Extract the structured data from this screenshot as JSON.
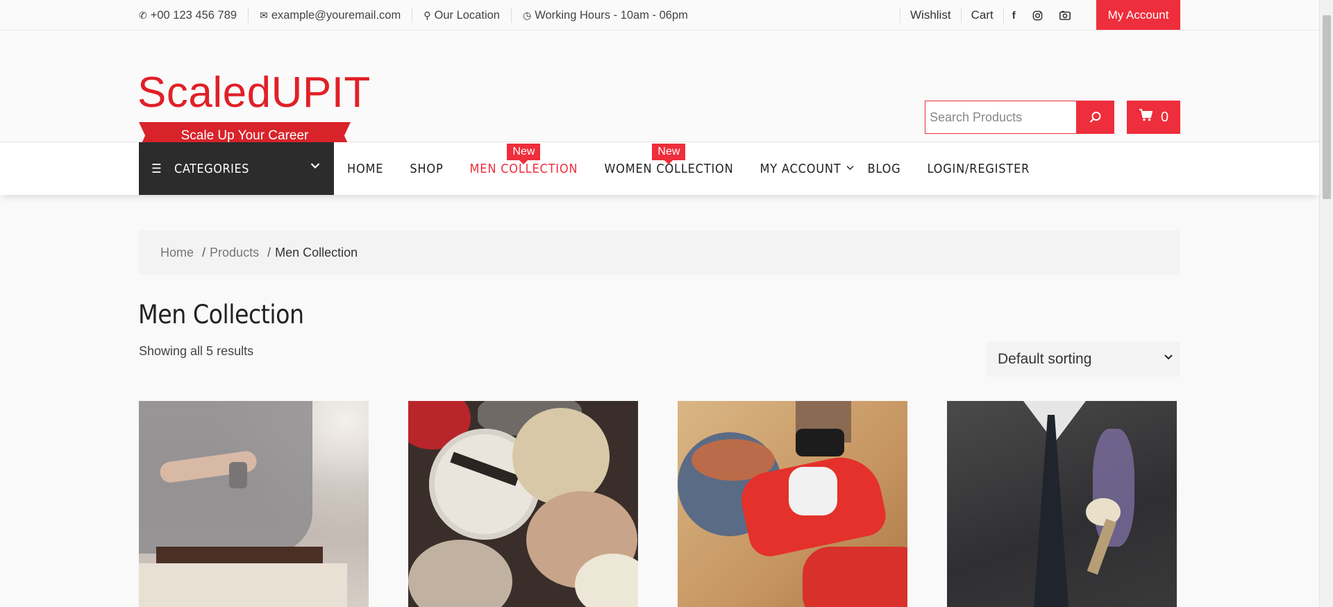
{
  "topbar": {
    "phone": "+00 123 456 789",
    "email": "example@youremail.com",
    "location": "Our Location",
    "hours": "Working Hours - 10am - 06pm",
    "wishlist": "Wishlist",
    "cart": "Cart",
    "account": "My Account",
    "social_icons": [
      "facebook-icon",
      "instagram-icon",
      "camera-icon"
    ]
  },
  "header": {
    "logo_title": "ScaledUPIT",
    "logo_tagline": "Scale Up Your Career",
    "search_placeholder": "Search Products",
    "cart_count": "0"
  },
  "nav": {
    "categories_label": "CATEGORIES",
    "items": [
      {
        "label": "HOME"
      },
      {
        "label": "SHOP"
      },
      {
        "label": "MEN COLLECTION",
        "badge": "New",
        "active": true
      },
      {
        "label": "WOMEN COLLECTION",
        "badge": "New"
      },
      {
        "label": "MY ACCOUNT"
      },
      {
        "label": "BLOG"
      },
      {
        "label": "LOGIN/REGISTER"
      }
    ]
  },
  "breadcrumb": {
    "home": "Home",
    "products": "Products",
    "current": "Men Collection",
    "separator": "/"
  },
  "main": {
    "title": "Men Collection",
    "result_count": "Showing all 5 results",
    "sorting": "Default sorting"
  },
  "colors": {
    "accent": "#ee2e3c",
    "dark": "#2c2c2c"
  }
}
